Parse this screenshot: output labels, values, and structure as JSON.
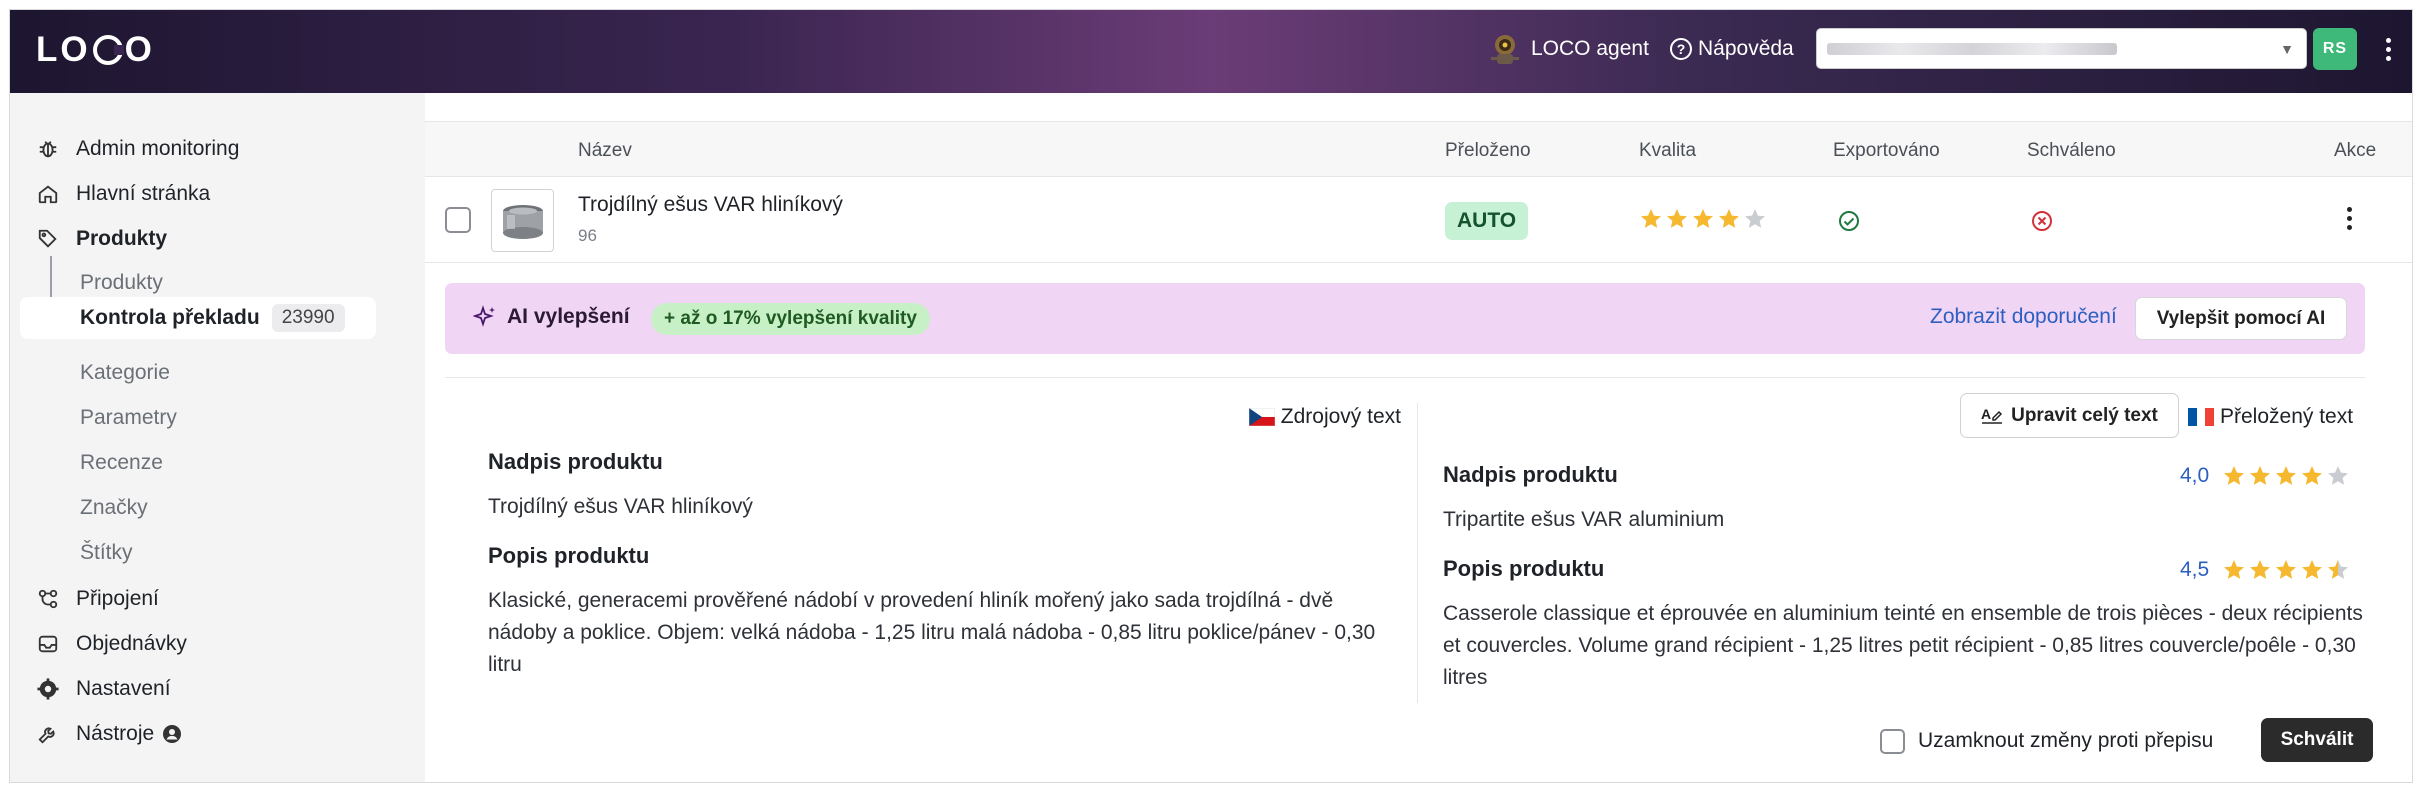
{
  "header": {
    "logo_text": "LOCO",
    "agent_label": "LOCO agent",
    "help_label": "Nápověda",
    "avatar_initials": "RS"
  },
  "sidebar": {
    "items": [
      {
        "label": "Admin monitoring",
        "icon": "bug-icon"
      },
      {
        "label": "Hlavní stránka",
        "icon": "home-icon"
      },
      {
        "label": "Produkty",
        "icon": "tag-icon"
      },
      {
        "label": "Připojení",
        "icon": "connections-icon"
      },
      {
        "label": "Objednávky",
        "icon": "inbox-icon"
      },
      {
        "label": "Nastavení",
        "icon": "gear-icon"
      },
      {
        "label": "Nástroje",
        "icon": "wrench-icon"
      }
    ],
    "sub_items": [
      "Produkty",
      "Kontrola překladu",
      "Kategorie",
      "Parametry",
      "Recenze",
      "Značky",
      "Štítky"
    ],
    "active_count": "23990"
  },
  "table": {
    "columns": [
      "Název",
      "Přeloženo",
      "Kvalita",
      "Exportováno",
      "Schváleno",
      "Akce"
    ],
    "row": {
      "name": "Trojdílný ešus VAR hliníkový",
      "id": "96",
      "translated": "AUTO",
      "quality_stars": 4,
      "exported": true,
      "approved": false
    }
  },
  "ai_banner": {
    "title": "AI vylepšení",
    "pill": "+ až o 17% vylepšení kvality",
    "link": "Zobrazit doporučení",
    "button": "Vylepšit pomocí AI"
  },
  "source": {
    "label": "Zdrojový text",
    "heading_title": "Nadpis produktu",
    "heading_text": "Trojdílný ešus VAR hliníkový",
    "desc_title": "Popis produktu",
    "desc_text": "Klasické, generacemi prověřené nádobí v provedení hliník mořený jako sada trojdílná - dvě nádoby a poklice. Objem: velká nádoba - 1,25 litru malá nádoba - 0,85 litru poklice/pánev - 0,30 litru"
  },
  "translation": {
    "edit_button": "Upravit celý text",
    "label": "Přeložený text",
    "heading_title": "Nadpis produktu",
    "heading_score": "4,0",
    "heading_stars": 4.0,
    "heading_text": "Tripartite ešus VAR aluminium",
    "desc_title": "Popis produktu",
    "desc_score": "4,5",
    "desc_stars": 4.5,
    "desc_text": "Casserole classique et éprouvée en aluminium teinté en ensemble de trois pièces - deux récipients et couvercles. Volume grand récipient - 1,25 litres petit récipient - 0,85 litres couvercle/poêle - 0,30 litres"
  },
  "footer": {
    "lock_label": "Uzamknout změny proti přepisu",
    "approve_button": "Schválit"
  },
  "colors": {
    "star_filled": "#f5b82e",
    "star_empty": "#c9ccd1",
    "accent_link": "#2d5fc0",
    "ai_banner_bg": "#f0d5f5",
    "approve_bg": "#2b2b2b"
  }
}
